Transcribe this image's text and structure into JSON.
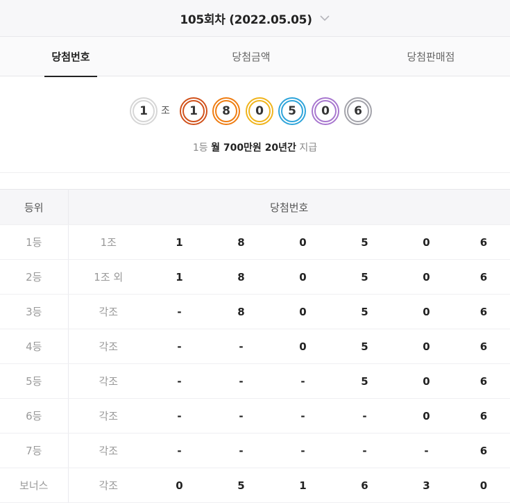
{
  "header": {
    "round_title": "105회차 (2022.05.05)",
    "dropdown_icon": "chevron-down-icon"
  },
  "tabs": [
    {
      "label": "당첨번호",
      "active": true
    },
    {
      "label": "당첨금액",
      "active": false
    },
    {
      "label": "당첨판매점",
      "active": false
    }
  ],
  "draw": {
    "group": "1",
    "group_suffix": "조",
    "numbers": [
      "1",
      "8",
      "0",
      "5",
      "0",
      "6"
    ],
    "colors": {
      "group": "#d6d6d6",
      "numbers": [
        "#d1521c",
        "#ef7d12",
        "#f0b41c",
        "#2ea4da",
        "#a877cf",
        "#a3a3aa"
      ]
    }
  },
  "prize_summary": {
    "prefix": "1등",
    "amount": "월 700만원 20년간",
    "suffix": "지급"
  },
  "table": {
    "headers": {
      "rank": "등위",
      "numbers": "당첨번호"
    },
    "rows": [
      {
        "rank": "1등",
        "cond": "1조",
        "nums": [
          "1",
          "8",
          "0",
          "5",
          "0",
          "6"
        ]
      },
      {
        "rank": "2등",
        "cond": "1조 외",
        "nums": [
          "1",
          "8",
          "0",
          "5",
          "0",
          "6"
        ]
      },
      {
        "rank": "3등",
        "cond": "각조",
        "nums": [
          "-",
          "8",
          "0",
          "5",
          "0",
          "6"
        ]
      },
      {
        "rank": "4등",
        "cond": "각조",
        "nums": [
          "-",
          "-",
          "0",
          "5",
          "0",
          "6"
        ]
      },
      {
        "rank": "5등",
        "cond": "각조",
        "nums": [
          "-",
          "-",
          "-",
          "5",
          "0",
          "6"
        ]
      },
      {
        "rank": "6등",
        "cond": "각조",
        "nums": [
          "-",
          "-",
          "-",
          "-",
          "0",
          "6"
        ]
      },
      {
        "rank": "7등",
        "cond": "각조",
        "nums": [
          "-",
          "-",
          "-",
          "-",
          "-",
          "6"
        ]
      },
      {
        "rank": "보너스",
        "cond": "각조",
        "nums": [
          "0",
          "5",
          "1",
          "6",
          "3",
          "0"
        ]
      }
    ]
  }
}
